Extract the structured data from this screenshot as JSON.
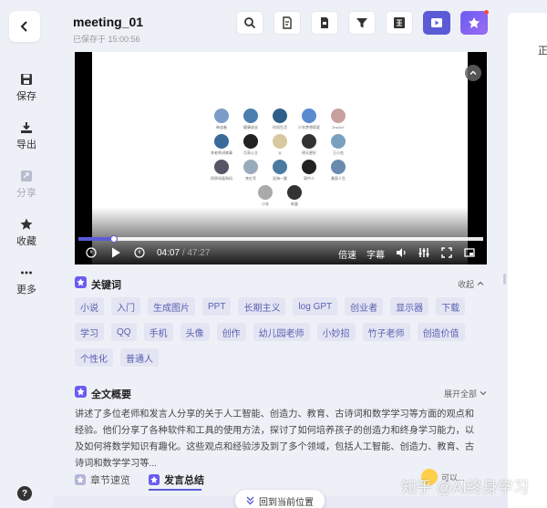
{
  "sidebar": {
    "items": [
      {
        "label": "保存",
        "icon": "save-icon",
        "enabled": true
      },
      {
        "label": "导出",
        "icon": "download-icon",
        "enabled": true
      },
      {
        "label": "分享",
        "icon": "share-icon",
        "enabled": false
      },
      {
        "label": "收藏",
        "icon": "star-icon",
        "enabled": true
      },
      {
        "label": "更多",
        "icon": "more-icon",
        "enabled": true
      }
    ],
    "help": "?"
  },
  "header": {
    "title": "meeting_01",
    "saved_status": "已保存于 15:00:56"
  },
  "right_panel": {
    "text": "正"
  },
  "video": {
    "current_time": "04:07",
    "separator": "/",
    "total_time": "47:27",
    "progress": 0.087,
    "speed_label": "倍速",
    "subtitle_label": "字幕",
    "participants": [
      {
        "name": "神战者"
      },
      {
        "name": "健康成长"
      },
      {
        "name": "时尚生活"
      },
      {
        "name": "少年梦想家庭"
      },
      {
        "name": "2ndJoY"
      },
      {
        "name": "李老师讲故事"
      },
      {
        "name": "月亮公主"
      },
      {
        "name": "乂"
      },
      {
        "name": "明天更好"
      },
      {
        "name": "王小花"
      },
      {
        "name": "四季如画和风"
      },
      {
        "name": "李红军"
      },
      {
        "name": "沧海一粟"
      },
      {
        "name": "雨中人"
      },
      {
        "name": "美丽人生"
      },
      {
        "name": "小灰"
      },
      {
        "name": "新蛋"
      }
    ]
  },
  "keywords": {
    "title": "关键词",
    "collapse_label": "收起",
    "items": [
      "小说",
      "入门",
      "生成图片",
      "PPT",
      "长期主义",
      "log GPT",
      "创业者",
      "显示器",
      "下载",
      "学习",
      "QQ",
      "手机",
      "头像",
      "创作",
      "幼儿园老师",
      "小妙招",
      "竹子老师",
      "创造价值",
      "个性化",
      "普通人"
    ]
  },
  "summary": {
    "title": "全文概要",
    "expand_label": "展开全部",
    "text": "讲述了多位老师和发言人分享的关于人工智能、创造力、教育、古诗词和数学学习等方面的观点和经验。他们分享了各种软件和工具的使用方法，探讨了如何培养孩子的创造力和终身学习能力，以及如何将数学知识有趣化。这些观点和经验涉及到了多个领域，包括人工智能、创造力、教育、古诗词和数学学习等..."
  },
  "tabs": [
    {
      "label": "章节速览",
      "active": false
    },
    {
      "label": "发言总结",
      "active": true
    }
  ],
  "return_button": "回到当前位置",
  "floating": {
    "label": "可以..."
  },
  "watermark": "知乎 @AI终身学习",
  "colors": {
    "accent": "#5b5bd6",
    "keyword_bg": "#e3e5f3",
    "keyword_text": "#5a5fb0",
    "page_bg": "#eef0f7"
  }
}
